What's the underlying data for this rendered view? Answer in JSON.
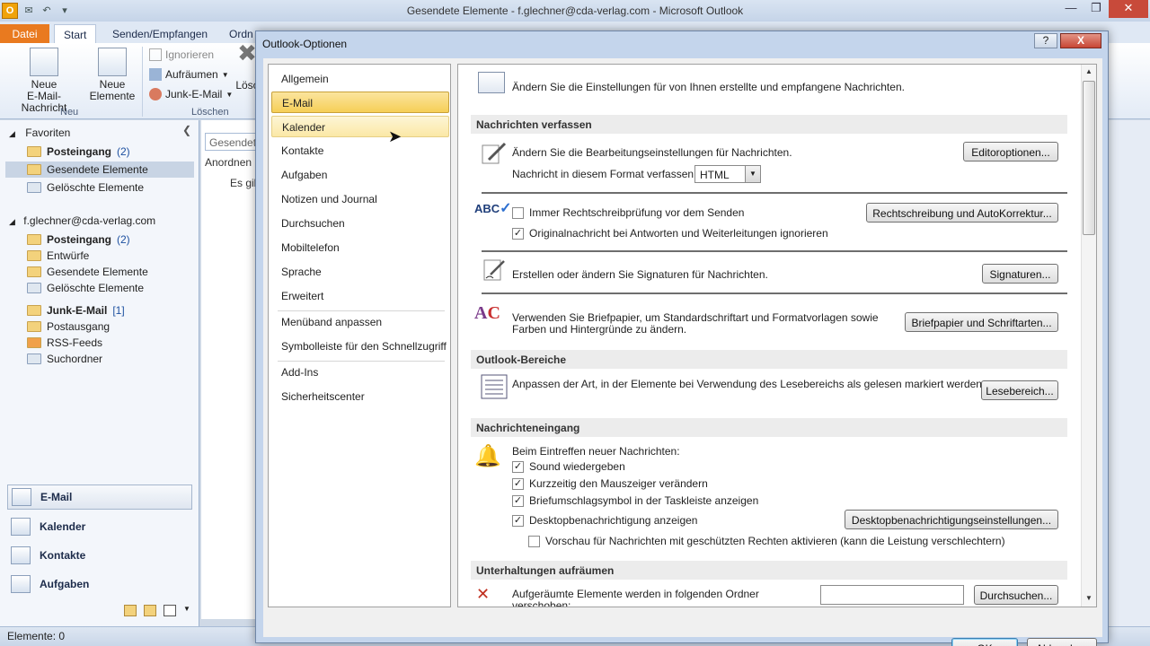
{
  "window": {
    "title": "Gesendete Elemente - f.glechner@cda-verlag.com - Microsoft Outlook",
    "logo_letter": "O"
  },
  "ribbon": {
    "tabs": {
      "datei": "Datei",
      "start": "Start",
      "senden": "Senden/Empfangen",
      "ordner": "Ordn"
    },
    "neue_email": "Neue\nE-Mail-Nachricht",
    "neue_elemente": "Neue\nElemente",
    "group_neu": "Neu",
    "ignorieren": "Ignorieren",
    "aufraeumen": "Aufräumen",
    "junk": "Junk-E-Mail",
    "group_loeschen": "Löschen",
    "loesch_trunc": "Lösc"
  },
  "navpane": {
    "favoriten_header": "Favoriten",
    "favoriten": [
      {
        "label": "Posteingang",
        "count": "(2)"
      },
      {
        "label": "Gesendete Elemente"
      },
      {
        "label": "Gelöschte Elemente"
      }
    ],
    "account_header": "f.glechner@cda-verlag.com",
    "account_items": [
      {
        "label": "Posteingang",
        "count": "(2)"
      },
      {
        "label": "Entwürfe"
      },
      {
        "label": "Gesendete Elemente"
      },
      {
        "label": "Gelöschte Elemente"
      },
      {
        "label": "Junk-E-Mail",
        "count": "[1]"
      },
      {
        "label": "Postausgang"
      },
      {
        "label": "RSS-Feeds"
      },
      {
        "label": "Suchordner"
      }
    ],
    "buttons": {
      "email": "E-Mail",
      "kalender": "Kalender",
      "kontakte": "Kontakte",
      "aufgaben": "Aufgaben"
    }
  },
  "list": {
    "search": "Gesendete",
    "arrange": "Anordnen",
    "empty": "Es gib"
  },
  "status": {
    "text": "Elemente: 0"
  },
  "dialog": {
    "title": "Outlook-Optionen",
    "help": "?",
    "close": "X",
    "categories": [
      "Allgemein",
      "E-Mail",
      "Kalender",
      "Kontakte",
      "Aufgaben",
      "Notizen und Journal",
      "Durchsuchen",
      "Mobiltelefon",
      "Sprache",
      "Erweitert",
      "Menüband anpassen",
      "Symbolleiste für den Schnellzugriff",
      "Add-Ins",
      "Sicherheitscenter"
    ],
    "intro": "Ändern Sie die Einstellungen für von Ihnen erstellte und empfangene Nachrichten.",
    "sections": {
      "verfassen": "Nachrichten verfassen",
      "bereiche": "Outlook-Bereiche",
      "eingang": "Nachrichteneingang",
      "aufraeumen": "Unterhaltungen aufräumen"
    },
    "verfassen": {
      "edit_text": "Ändern Sie die Bearbeitungseinstellungen für Nachrichten.",
      "edit_btn": "Editoroptionen...",
      "format_label": "Nachricht in diesem Format verfassen:",
      "format_value": "HTML",
      "spell_check": "Immer Rechtschreibprüfung vor dem Senden",
      "spell_checked": false,
      "ignore_orig": "Originalnachricht bei Antworten und Weiterleitungen ignorieren",
      "ignore_checked": true,
      "spell_btn": "Rechtschreibung und AutoKorrektur...",
      "sig_text": "Erstellen oder ändern Sie Signaturen für Nachrichten.",
      "sig_btn": "Signaturen...",
      "stationery_text": "Verwenden Sie Briefpapier, um Standardschriftart und Formatvorlagen sowie\nFarben und Hintergründe zu ändern.",
      "stationery_btn": "Briefpapier und Schriftarten..."
    },
    "bereiche": {
      "text": "Anpassen der Art, in der Elemente bei Verwendung des Lesebereichs als gelesen markiert werden.",
      "btn": "Lesebereich..."
    },
    "eingang": {
      "intro": "Beim Eintreffen neuer Nachrichten:",
      "sound": "Sound wiedergeben",
      "mouse": "Kurzzeitig den Mauszeiger verändern",
      "envelope": "Briefumschlagsymbol in der Taskleiste anzeigen",
      "desktop": "Desktopbenachrichtigung anzeigen",
      "desktop_btn": "Desktopbenachrichtigungseinstellungen...",
      "preview": "Vorschau für Nachrichten mit geschützten Rechten aktivieren (kann die Leistung verschlechtern)",
      "check_mark": "✓"
    },
    "aufraeumen": {
      "text": "Aufgeräumte Elemente werden in folgenden Ordner\nverschoben:",
      "btn": "Durchsuchen..."
    },
    "ok": "OK",
    "cancel": "Abbrechen"
  }
}
